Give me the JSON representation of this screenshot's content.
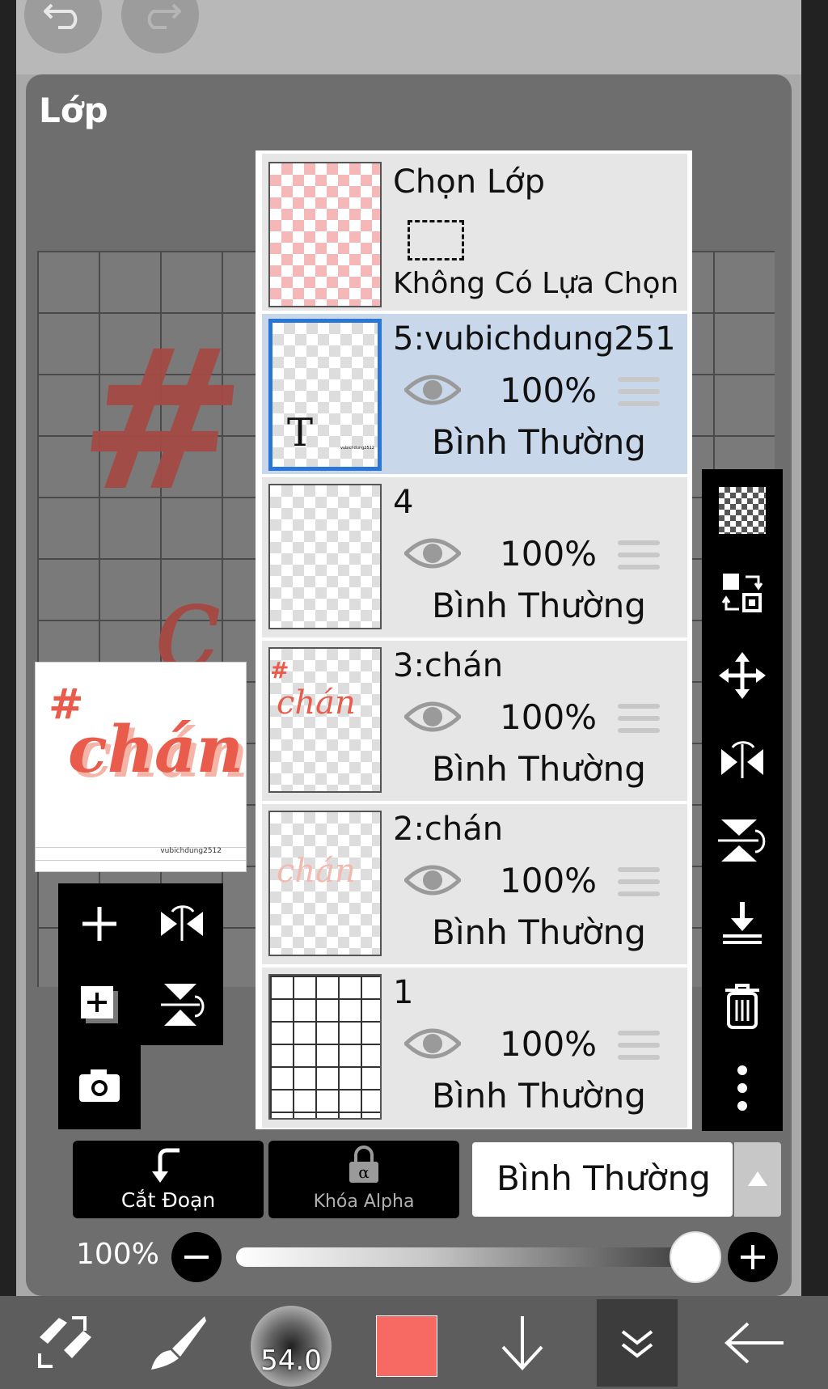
{
  "panel": {
    "title": "Lớp"
  },
  "selection_layer": {
    "title": "Chọn Lớp",
    "status": "Không Có Lựa Chọn"
  },
  "layers": [
    {
      "name": "5:vubichdung251",
      "opacity": "100%",
      "blend": "Bình Thường",
      "selected": true,
      "thumb_letter": "T",
      "thumb_caption": "vubichdung2512"
    },
    {
      "name": "4",
      "opacity": "100%",
      "blend": "Bình Thường",
      "selected": false
    },
    {
      "name": "3:chán",
      "opacity": "100%",
      "blend": "Bình Thường",
      "selected": false,
      "thumb_text": "chán"
    },
    {
      "name": "2:chán",
      "opacity": "100%",
      "blend": "Bình Thường",
      "selected": false,
      "thumb_text": "chán"
    },
    {
      "name": "1",
      "opacity": "100%",
      "blend": "Bình Thường",
      "selected": false
    }
  ],
  "preview": {
    "hash": "#",
    "word": "chán",
    "signature": "vubichdung2512"
  },
  "actions": {
    "clip_label": "Cắt Đoạn",
    "alpha_lock_label": "Khóa Alpha",
    "blend_mode": "Bình Thường"
  },
  "opacity": {
    "label": "100%",
    "value": 1.0
  },
  "brush": {
    "size": "54.0"
  },
  "colors": {
    "accent": "#2a76d6",
    "current_color": "#f76a63",
    "canvas_mark": "#a44a45"
  }
}
